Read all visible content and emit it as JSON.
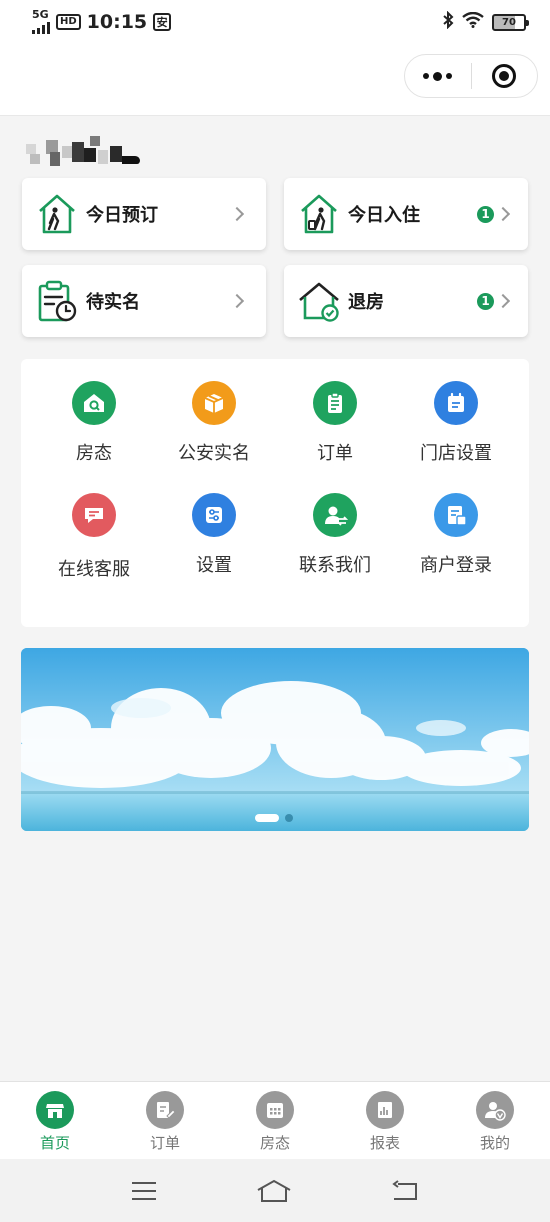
{
  "status_bar": {
    "network": "5G",
    "hd": "HD",
    "time": "10:15",
    "safe_icon": "安",
    "battery": "70"
  },
  "capsule": {
    "more_icon": "more-dots-icon",
    "close_icon": "target-close-icon"
  },
  "quick_cards": [
    {
      "label": "今日预订",
      "icon": "walk-in-house-icon",
      "badge": ""
    },
    {
      "label": "今日入住",
      "icon": "walk-in-house-icon",
      "badge": "1"
    },
    {
      "label": "待实名",
      "icon": "clipboard-clock-icon",
      "badge": ""
    },
    {
      "label": "退房",
      "icon": "house-check-icon",
      "badge": "1"
    }
  ],
  "menu": [
    {
      "label": "房态",
      "icon": "house-search-icon",
      "color": "#1fa35f"
    },
    {
      "label": "公安实名",
      "icon": "box-icon",
      "color": "#f29b1a"
    },
    {
      "label": "订单",
      "icon": "clipboard-icon",
      "color": "#1fa35f"
    },
    {
      "label": "门店设置",
      "icon": "calendar-note-icon",
      "color": "#2f80e0"
    },
    {
      "label": "在线客服",
      "icon": "chat-icon",
      "color": "#e25a5f"
    },
    {
      "label": "设置",
      "icon": "sliders-icon",
      "color": "#2f80e0"
    },
    {
      "label": "联系我们",
      "icon": "user-swap-icon",
      "color": "#1fa35f"
    },
    {
      "label": "商户登录",
      "icon": "merchant-doc-icon",
      "color": "#3b99e8"
    }
  ],
  "banner": {
    "slides": 2,
    "active_slide": 1
  },
  "tab_bar": [
    {
      "label": "首页",
      "icon": "store-icon",
      "active": true
    },
    {
      "label": "订单",
      "icon": "order-edit-icon",
      "active": false
    },
    {
      "label": "房态",
      "icon": "calendar-grid-icon",
      "active": false
    },
    {
      "label": "报表",
      "icon": "report-chart-icon",
      "active": false
    },
    {
      "label": "我的",
      "icon": "user-verified-icon",
      "active": false
    }
  ],
  "colors": {
    "brand_green": "#1b9a5b",
    "tab_inactive": "#999999"
  }
}
